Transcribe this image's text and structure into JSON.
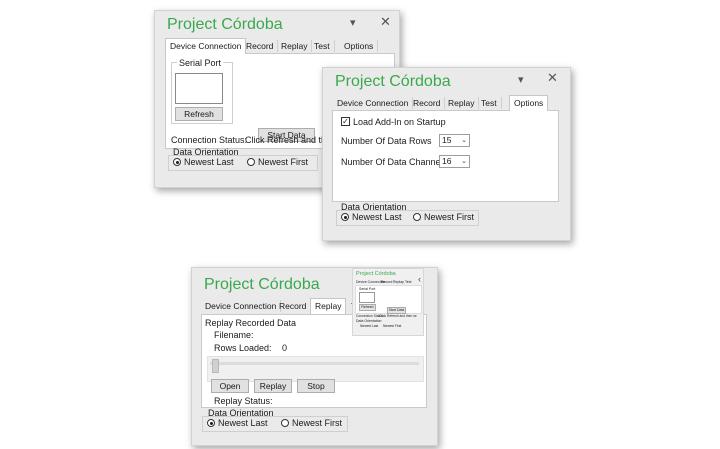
{
  "colors": {
    "brand_green": "#3aa94d",
    "pane_bg": "#eaeaea"
  },
  "pane1": {
    "title": "Project Córdoba",
    "tabs": [
      "Device Connection",
      "Record",
      "Replay",
      "Test",
      "Options"
    ],
    "active_tab": "Device Connection",
    "serial_port_label": "Serial Port",
    "refresh_label": "Refresh",
    "start_data_label": "Start Data",
    "connection_status_label": "Connection Status:",
    "connection_status_value": "Click Refresh and the",
    "orientation_title": "Data Orientation",
    "newest_last": "Newest Last",
    "newest_first": "Newest First",
    "selected_orientation": "Newest Last"
  },
  "pane2": {
    "title": "Project Córdoba",
    "tabs": [
      "Device Connection",
      "Record",
      "Replay",
      "Test",
      "Options"
    ],
    "active_tab": "Options",
    "load_addin_label": "Load Add-In on Startup",
    "load_addin_checked": true,
    "rows_label": "Number Of Data Rows",
    "rows_value": "15",
    "channels_label": "Number Of Data Channels",
    "channels_value": "16",
    "orientation_title": "Data Orientation",
    "newest_last": "Newest Last",
    "newest_first": "Newest First",
    "selected_orientation": "Newest Last"
  },
  "pane3": {
    "title": "Project Córdoba",
    "tabs": [
      "Device Connection",
      "Record",
      "Replay",
      "Te"
    ],
    "active_tab": "Replay",
    "replay_heading": "Replay Recorded Data",
    "filename_label": "Filename:",
    "rows_loaded_label": "Rows Loaded:",
    "rows_loaded_value": "0",
    "open_label": "Open",
    "replay_label": "Replay",
    "stop_label": "Stop",
    "replay_status_label": "Replay Status:",
    "orientation_title": "Data Orientation",
    "newest_last": "Newest Last",
    "newest_first": "Newest First",
    "selected_orientation": "Newest Last"
  },
  "thumbnail": {
    "title": "Project Córdoba",
    "tabs": [
      "Device Connection",
      "Record",
      "Replay",
      "Test"
    ],
    "serial_port_label": "Serial Port",
    "refresh_label": "Refresh",
    "start_data_label": "Start Data",
    "connection_status_label": "Connection Status:",
    "connection_status_value": "Click Refresh and then se",
    "orientation_title": "Data Orientation",
    "newest_last": "Newest Last",
    "newest_first": "Newest First"
  },
  "icons": {
    "collapse": "chevron-down-icon",
    "close": "close-icon"
  }
}
